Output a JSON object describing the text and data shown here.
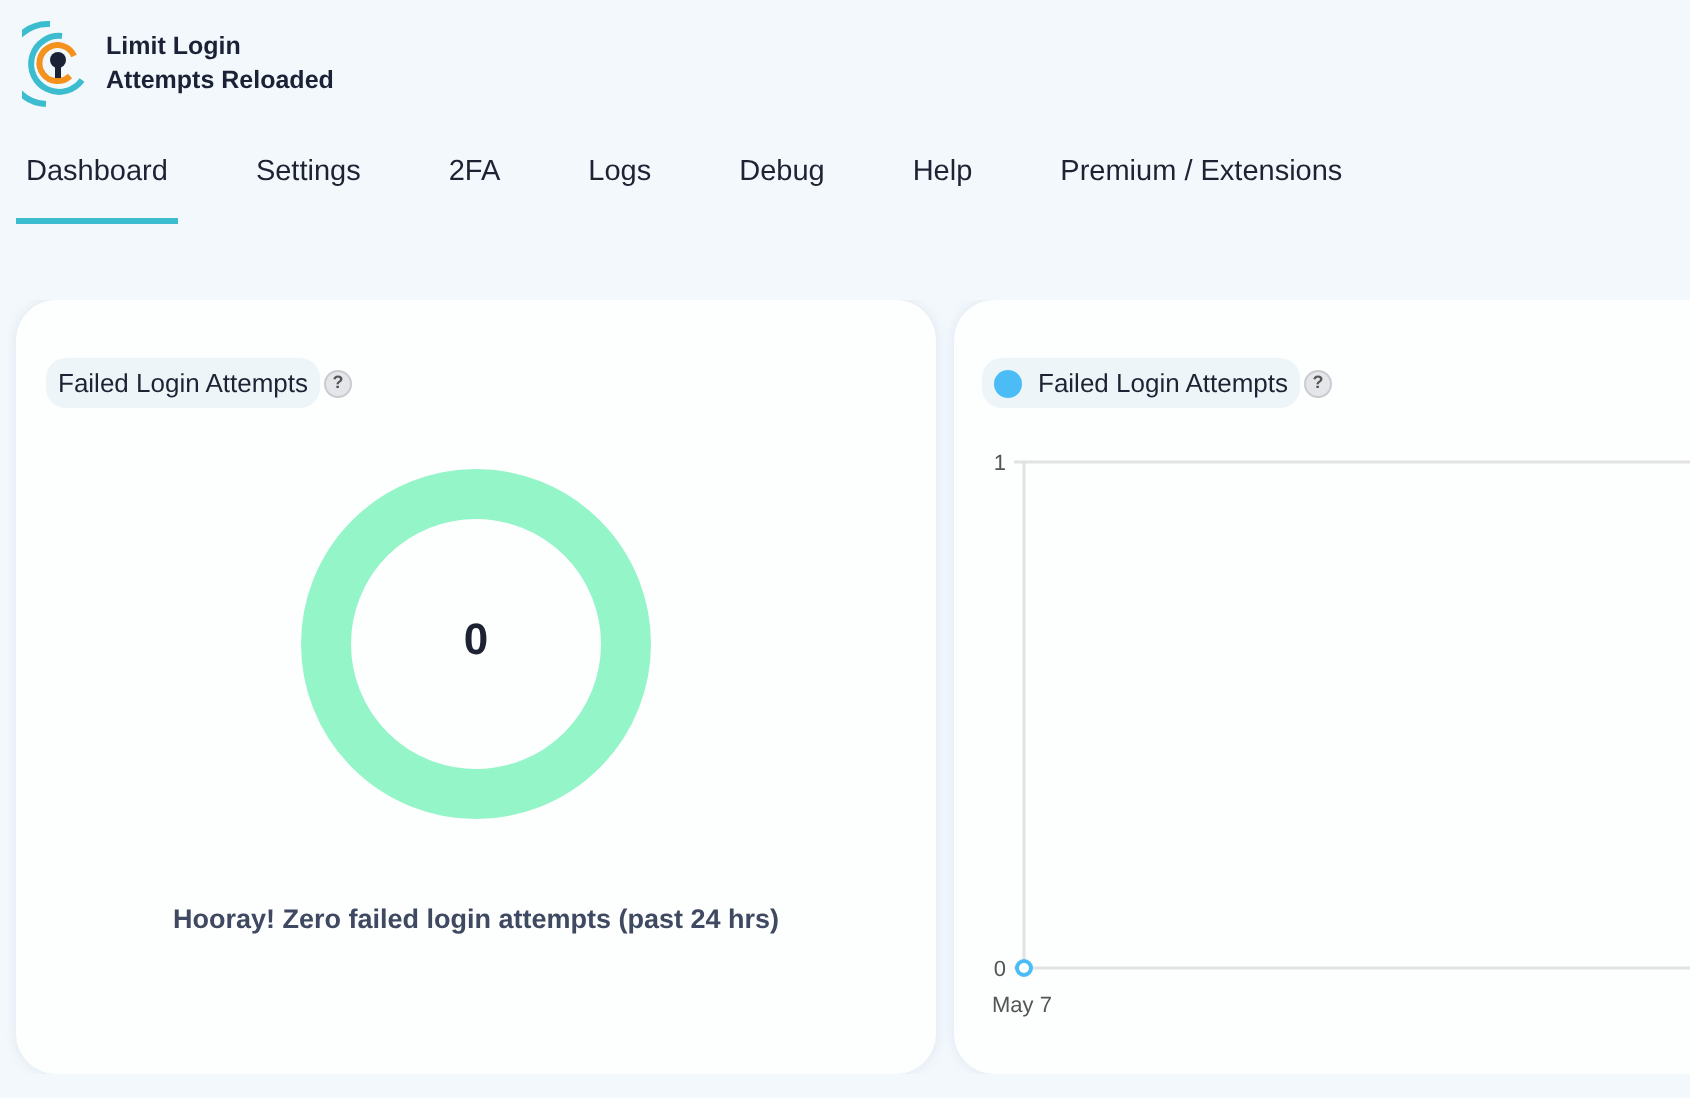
{
  "app": {
    "title_lines": [
      "Limit Login",
      "Attempts Reloaded"
    ]
  },
  "tabs": [
    {
      "label": "Dashboard",
      "selected": true
    },
    {
      "label": "Settings",
      "selected": false
    },
    {
      "label": "2FA",
      "selected": false
    },
    {
      "label": "Logs",
      "selected": false
    },
    {
      "label": "Debug",
      "selected": false
    },
    {
      "label": "Help",
      "selected": false
    },
    {
      "label": "Premium / Extensions",
      "selected": false
    }
  ],
  "failed_card": {
    "label": "Failed Login Attempts",
    "help": "?",
    "count": "0",
    "message": "Hooray! Zero failed login attempts (past 24 hrs)"
  },
  "chart_card": {
    "help": "?",
    "chart_data": {
      "type": "line",
      "categories": [
        "May 7"
      ],
      "ylim": [
        0,
        1
      ],
      "yticks": [
        0,
        1
      ],
      "series": [
        {
          "name": "Failed Login Attempts",
          "color": "#4cbcf7",
          "marker": "circle",
          "values": [
            0
          ]
        }
      ]
    }
  }
}
